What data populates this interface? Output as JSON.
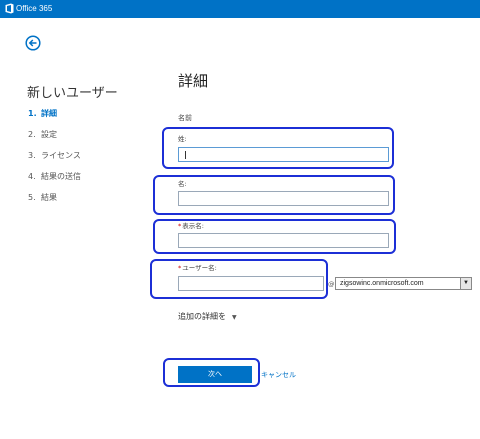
{
  "app": {
    "brand": "Office 365"
  },
  "wizard": {
    "title": "新しいユーザー",
    "steps": [
      {
        "num": "1.",
        "label": "詳細"
      },
      {
        "num": "2.",
        "label": "設定"
      },
      {
        "num": "3.",
        "label": "ライセンス"
      },
      {
        "num": "4.",
        "label": "結果の送信"
      },
      {
        "num": "5.",
        "label": "結果"
      }
    ]
  },
  "form": {
    "section_title": "詳細",
    "name_label": "名前",
    "last_name_label": "姓:",
    "first_name_label": "名:",
    "display_name_label": "表示名:",
    "username_label": "ユーザー名:",
    "required_mark": "*",
    "at_sign": "@",
    "domain_value": "zigsowinc.onmicrosoft.com",
    "more_details": "追加の詳細を"
  },
  "actions": {
    "next": "次へ",
    "cancel": "キャンセル"
  },
  "colors": {
    "brand": "#0072c6",
    "highlight": "#1c2fd6"
  }
}
